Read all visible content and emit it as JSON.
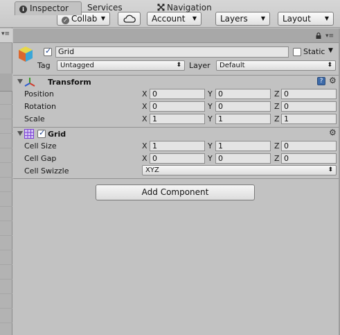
{
  "toolbar": {
    "collab": "Collab",
    "account": "Account",
    "layers": "Layers",
    "layout": "Layout"
  },
  "left_panel": {
    "menu_glyph": "▾≡"
  },
  "tabs": [
    {
      "label": "Inspector",
      "icon": "info-icon"
    },
    {
      "label": "Services"
    },
    {
      "label": "Navigation",
      "icon": "navigation-icon"
    }
  ],
  "tab_actions": {
    "lock": "🔒",
    "menu": "▾≡"
  },
  "object": {
    "name": "Grid",
    "active": true,
    "static_label": "Static",
    "static": false,
    "tag_label": "Tag",
    "tag": "Untagged",
    "layer_label": "Layer",
    "layer": "Default"
  },
  "transform": {
    "title": "Transform",
    "rows": [
      {
        "label": "Position",
        "x": "0",
        "y": "0",
        "z": "0"
      },
      {
        "label": "Rotation",
        "x": "0",
        "y": "0",
        "z": "0"
      },
      {
        "label": "Scale",
        "x": "1",
        "y": "1",
        "z": "1"
      }
    ]
  },
  "grid": {
    "title": "Grid",
    "enabled": true,
    "rows": [
      {
        "label": "Cell Size",
        "x": "1",
        "y": "1",
        "z": "0"
      },
      {
        "label": "Cell Gap",
        "x": "0",
        "y": "0",
        "z": "0"
      }
    ],
    "swizzle_label": "Cell Swizzle",
    "swizzle": "XYZ"
  },
  "axes": {
    "x": "X",
    "y": "Y",
    "z": "Z"
  },
  "add_component": "Add Component",
  "colors": {
    "panel_bg": "#c2c2c2",
    "grid_icon": "#7b3fd6",
    "checkbox_mark": "#1a3f8a"
  }
}
